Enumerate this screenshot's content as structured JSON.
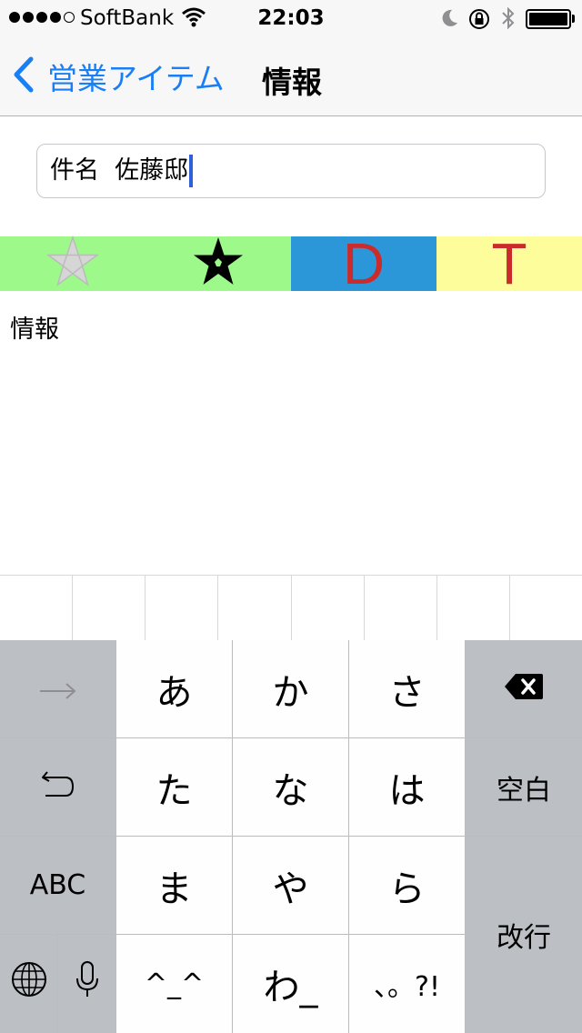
{
  "status_bar": {
    "carrier": "SoftBank",
    "time": "22:03",
    "signal_bars_filled": 4,
    "signal_bars_total": 5,
    "battery_level": 1.0
  },
  "nav": {
    "back_label": "営業アイテム",
    "title": "情報",
    "accent_color": "#1a7ff5"
  },
  "subject": {
    "value": "件名  佐藤邸"
  },
  "icon_strip": {
    "items": [
      {
        "icon": "star-outline-icon",
        "color": "#9dfa8a"
      },
      {
        "icon": "star-filled-icon",
        "color": "#9dfa8a"
      },
      {
        "label": "D",
        "color": "#2b97d8"
      },
      {
        "label": "T",
        "color": "#fdfd9c"
      }
    ]
  },
  "info": {
    "label": "情報"
  },
  "keyboard": {
    "keys": {
      "a": "あ",
      "ka": "か",
      "sa": "さ",
      "ta": "た",
      "na": "な",
      "ha": "は",
      "space": "空白",
      "abc": "ABC",
      "ma": "ま",
      "ya": "や",
      "ra": "ら",
      "return": "改行",
      "kaomoji": "^_^",
      "wa": "わ_",
      "punct": "、。?!"
    },
    "icons": [
      "arrow-right-icon",
      "delete-icon",
      "undo-icon",
      "globe-icon",
      "microphone-icon"
    ]
  }
}
